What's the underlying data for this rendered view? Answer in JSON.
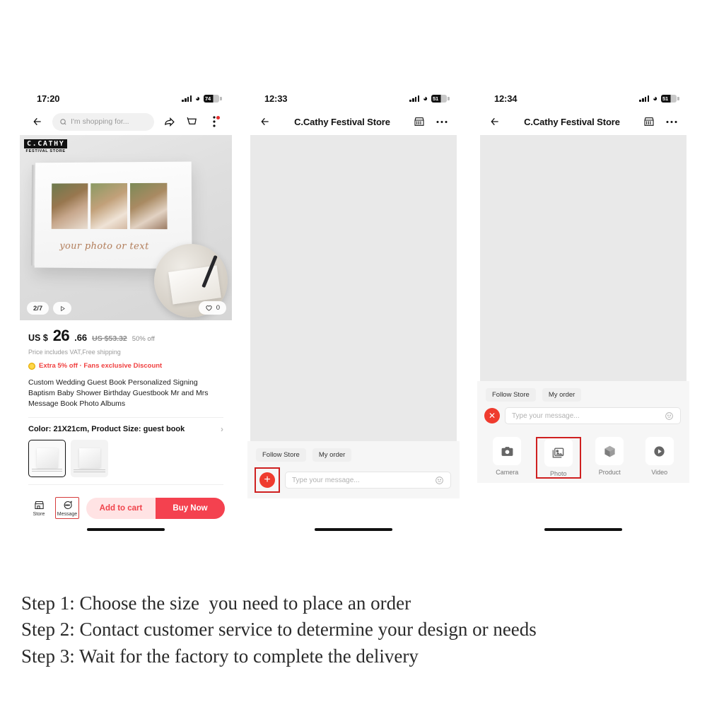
{
  "panels": [
    {
      "id": "product-page",
      "status": {
        "time": "17:20",
        "battery": "74"
      },
      "nav": {
        "search_placeholder": "I'm shopping for...",
        "back_icon": "back-arrow-icon",
        "share_icon": "share-icon",
        "cart_icon": "cart-icon",
        "more_icon": "more-vertical-icon"
      },
      "hero": {
        "brand_line1": "C.CATHY",
        "brand_line2": "FESTIVAL STORE",
        "book_caption": "your photo or text",
        "counter": "2/7",
        "play_icon": "play-icon",
        "like_icon": "heart-icon",
        "like_count": "0"
      },
      "price": {
        "currency": "US $",
        "amount": "26",
        "cents": ".66",
        "original": "US $53.32",
        "discount": "50% off",
        "vat_note": "Price includes VAT,Free shipping",
        "promo": "Extra 5% off · Fans exclusive Discount"
      },
      "title": "Custom Wedding Guest Book Personalized Signing Baptism Baby Shower Birthday Guestbook Mr and Mrs Message Book Photo Albums",
      "color_row": "Color: 21X21cm, Product Size: guest book",
      "actions": {
        "store_label": "Store",
        "store_icon": "storefront-icon",
        "message_label": "Message",
        "message_icon": "chat-bubble-icon",
        "add_to_cart": "Add to cart",
        "buy_now": "Buy Now"
      }
    },
    {
      "id": "chat-page",
      "status": {
        "time": "12:33",
        "battery": "51"
      },
      "nav": {
        "title": "C.Cathy Festival Store",
        "back_icon": "back-arrow-icon",
        "store_icon": "storefront-icon",
        "more_icon": "more-horizontal-icon"
      },
      "quick": [
        "Follow Store",
        "My order"
      ],
      "input": {
        "placeholder": "Type your message...",
        "plus_icon": "plus-circle-icon",
        "emoji_icon": "smiley-icon"
      }
    },
    {
      "id": "chat-attach-page",
      "status": {
        "time": "12:34",
        "battery": "51"
      },
      "nav": {
        "title": "C.Cathy Festival Store",
        "back_icon": "back-arrow-icon",
        "store_icon": "storefront-icon",
        "more_icon": "more-horizontal-icon"
      },
      "quick": [
        "Follow Store",
        "My order"
      ],
      "input": {
        "placeholder": "Type your message...",
        "close_icon": "close-circle-icon",
        "emoji_icon": "smiley-icon"
      },
      "attachments": [
        {
          "label": "Camera",
          "icon": "camera-icon"
        },
        {
          "label": "Photo",
          "icon": "image-icon"
        },
        {
          "label": "Product",
          "icon": "box-icon"
        },
        {
          "label": "Video",
          "icon": "video-play-icon"
        }
      ]
    }
  ],
  "steps": [
    "Step 1: Choose the size  you need to place an order",
    "Step 2: Contact customer service to determine your design or needs",
    "Step 3: Wait for the factory to complete the delivery"
  ],
  "colors": {
    "accent_red": "#f4414f",
    "highlight_box": "#cf2020",
    "arrow_red": "#e01b1b",
    "promo_red": "#f04040",
    "cart_pink": "#ffe3e4"
  }
}
